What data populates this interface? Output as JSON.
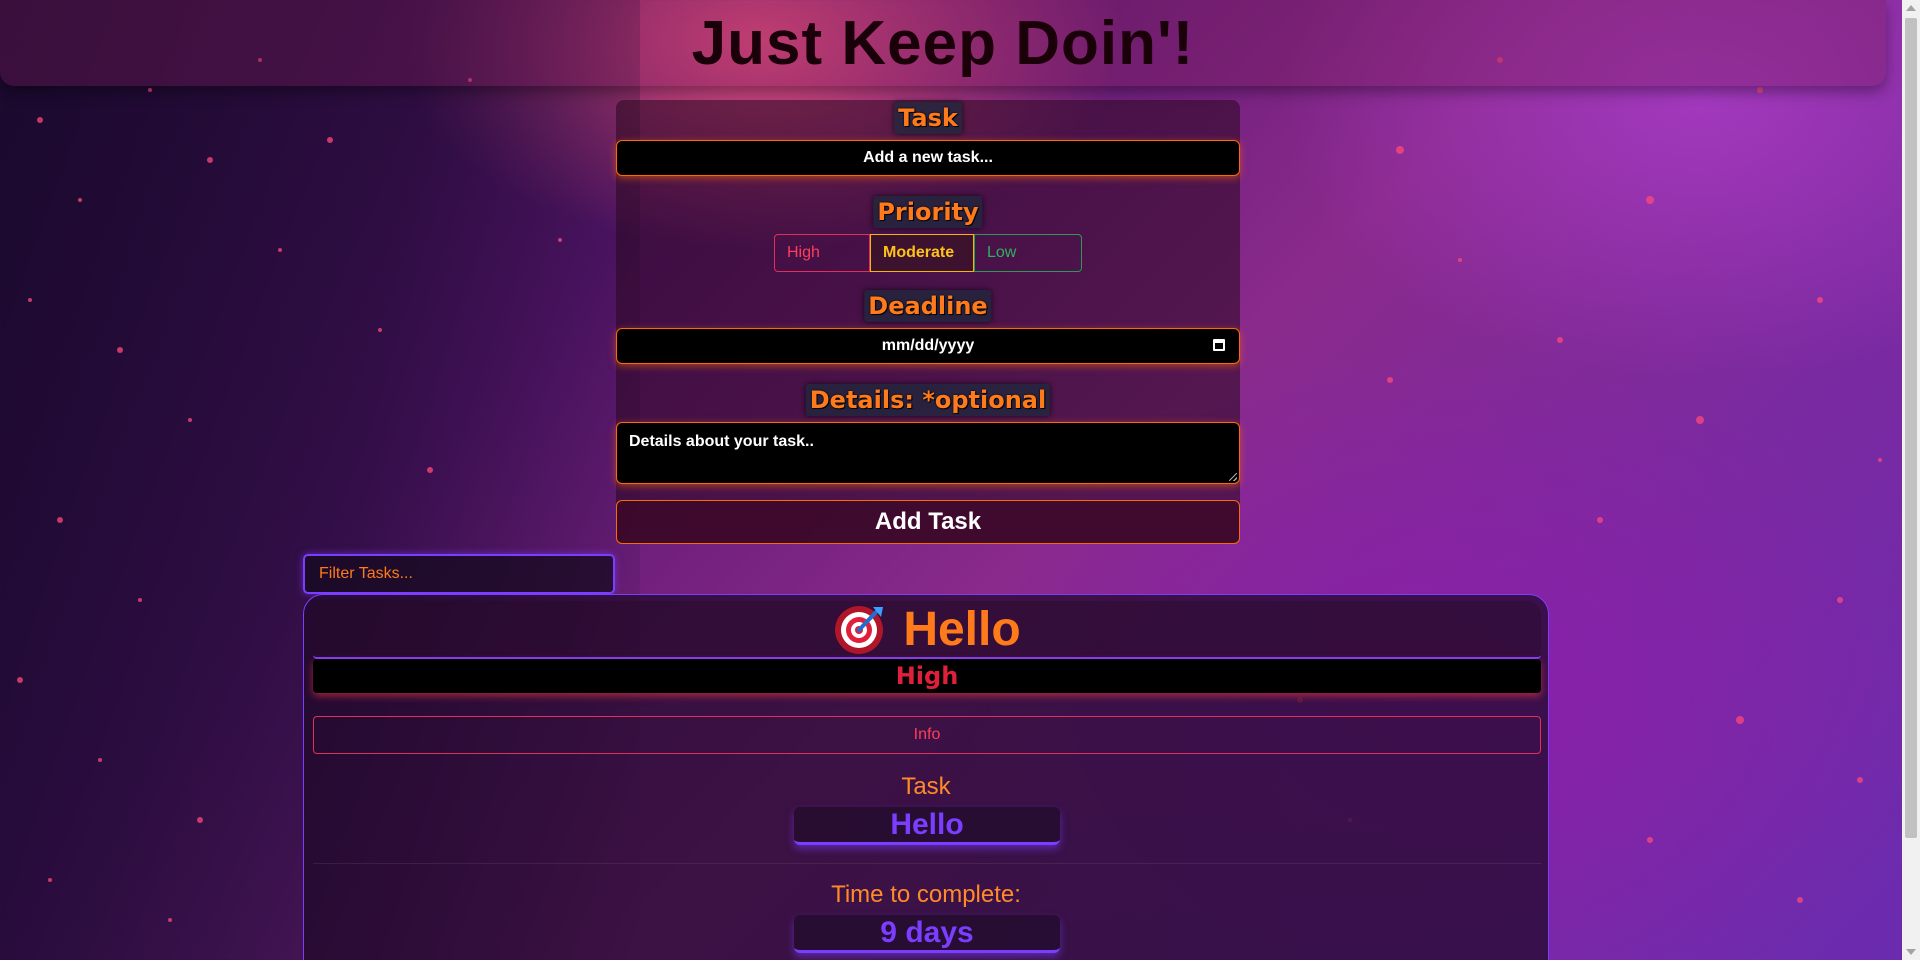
{
  "header": {
    "title": "Just Keep Doin'!"
  },
  "form": {
    "task_label": "Task",
    "task_placeholder": "Add a new task...",
    "priority_label": "Priority",
    "priority_options": [
      "High",
      "Moderate",
      "Low"
    ],
    "priority_selected": "Moderate",
    "deadline_label": "Deadline",
    "deadline_placeholder": "mm/dd/yyyy",
    "details_label": "Details: *optional",
    "details_placeholder": "Details about your task..",
    "add_button": "Add Task"
  },
  "filter": {
    "placeholder": "Filter Tasks..."
  },
  "task_card": {
    "title": "Hello",
    "icon": "target-dart-icon",
    "priority": "High",
    "info_button": "Info",
    "task_label": "Task",
    "task_value": "Hello",
    "time_label": "Time to complete:",
    "time_value": "9 days"
  },
  "colors": {
    "accent_orange": "#ff7a1a",
    "accent_purple": "#7b3dff",
    "priority_high": "#ff3d5a",
    "priority_moderate": "#ffc21a",
    "priority_low": "#2fb060"
  }
}
